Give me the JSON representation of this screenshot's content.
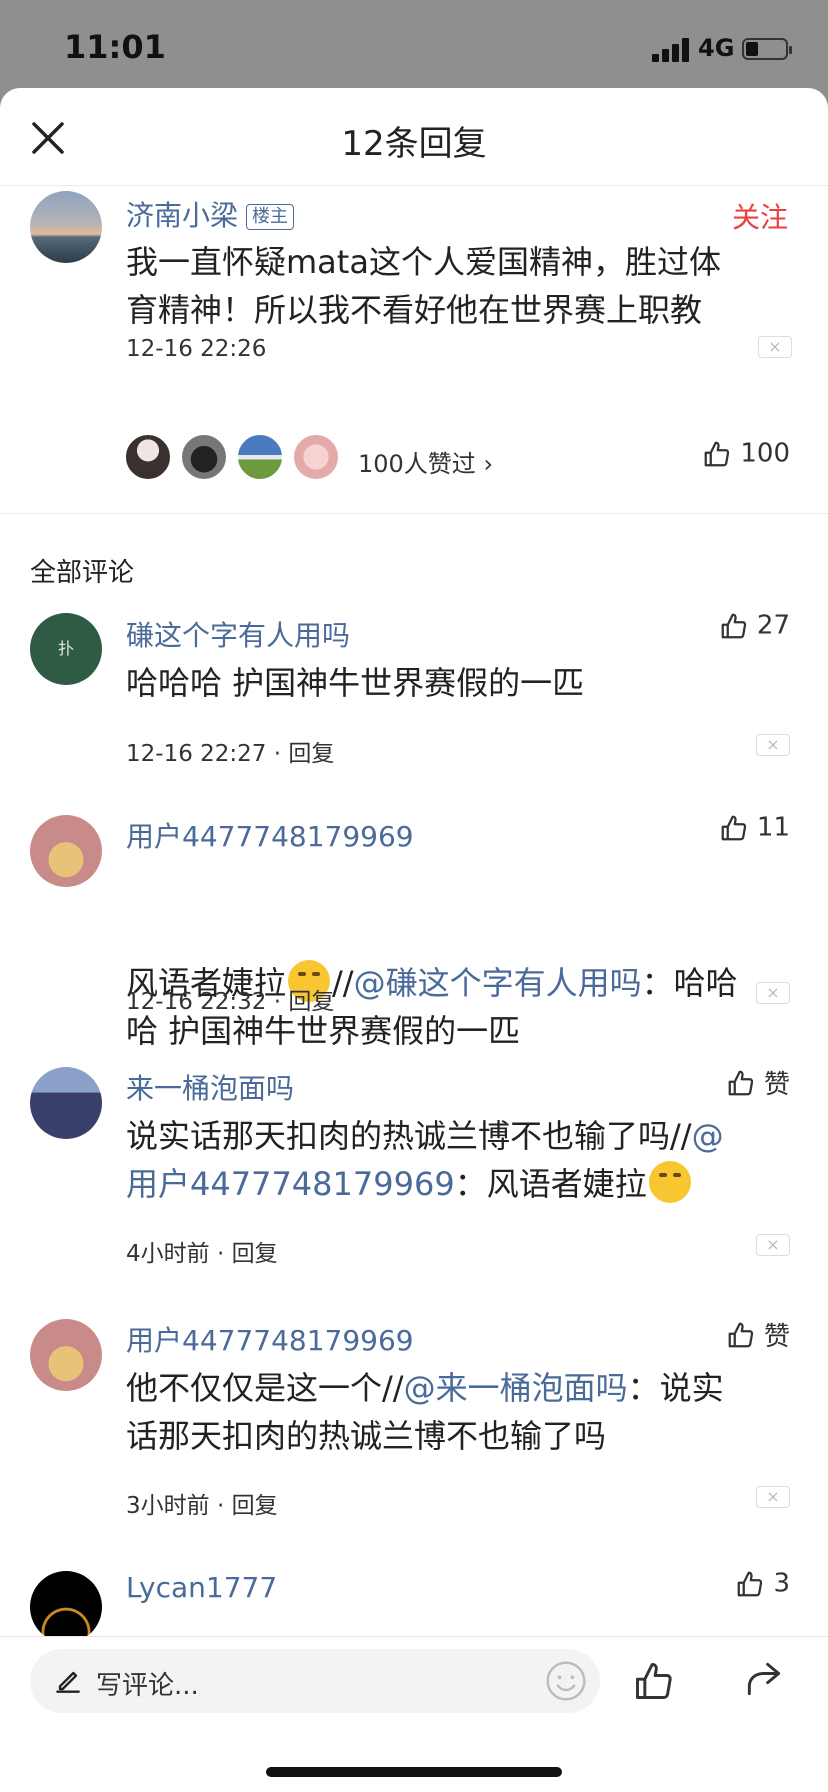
{
  "status_bar": {
    "time": "11:01",
    "network": "4G",
    "battery_level": 0.3
  },
  "header": {
    "title": "12条回复"
  },
  "main_comment": {
    "author": "济南小梁",
    "author_tag": "楼主",
    "follow_label": "关注",
    "text_line1": "我一直怀疑mata这个人爱国精神，胜过体",
    "text_line2": "育精神！所以我不看好他在世界赛上职教",
    "time": "12-16 22:26",
    "likers_text": "100人赞过",
    "likers_arrow": "›",
    "like_count": "100"
  },
  "section_title": "全部评论",
  "replies": [
    {
      "author": "磏这个字有人用吗",
      "likes": "27",
      "line1": "哈哈哈 护国神牛世界赛假的一匹",
      "meta": "12-16 22:27 · 回复"
    },
    {
      "author": "用户4477748179969",
      "likes": "11",
      "line1_a": "风语者婕拉",
      "line1_b": "//",
      "line1_mention": "@磏这个字有人用吗",
      "line1_c": "：哈哈",
      "line2": "哈 护国神牛世界赛假的一匹",
      "meta": "12-16 22:32 · 回复"
    },
    {
      "author": "来一桶泡面吗",
      "likes": "赞",
      "line1_a": "说实话那天扣肉的热诚兰博不也输了吗//",
      "line1_mention": "@",
      "line2_mention": "用户4477748179969",
      "line2_b": "：风语者婕拉",
      "meta": "4小时前 · 回复"
    },
    {
      "author": "用户4477748179969",
      "likes": "赞",
      "line1_a": "他不仅仅是这一个//",
      "line1_mention": "@来一桶泡面吗",
      "line1_b": "：说实",
      "line2": "话那天扣肉的热诚兰博不也输了吗",
      "meta": "3小时前 · 回复"
    },
    {
      "author": "Lycan1777",
      "likes": "3"
    }
  ],
  "close_mark": "×",
  "bottom_bar": {
    "placeholder": "写评论..."
  },
  "icons": {
    "close": "close-icon",
    "like": "thumbs-up-icon",
    "pencil": "pencil-icon",
    "emoji": "smiley-icon",
    "share": "share-icon"
  },
  "colors": {
    "link": "#4a6b9a",
    "follow": "#e84141"
  }
}
